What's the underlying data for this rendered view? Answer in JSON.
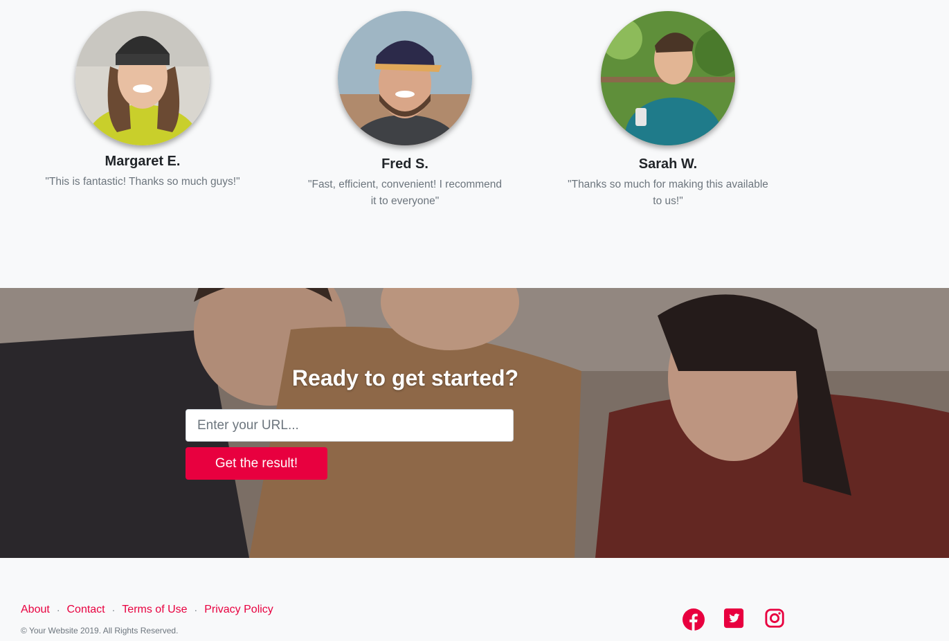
{
  "testimonials": [
    {
      "name": "Margaret E.",
      "quote": "\"This is fantastic! Thanks so much guys!\""
    },
    {
      "name": "Fred S.",
      "quote": "\"Fast, efficient, convenient! I recommend it to everyone\""
    },
    {
      "name": "Sarah W.",
      "quote": "\"Thanks so much for making this available to us!\""
    }
  ],
  "cta": {
    "title": "Ready to get started?",
    "input_placeholder": "Enter your URL...",
    "button_label": "Get the result!"
  },
  "footer": {
    "links": [
      "About",
      "Contact",
      "Terms of Use",
      "Privacy Policy"
    ],
    "separator": "·",
    "copyright": "© Your Website 2019. All Rights Reserved.",
    "social": [
      "facebook-icon",
      "twitter-icon",
      "instagram-icon"
    ]
  },
  "colors": {
    "accent": "#e8003f",
    "muted": "#6c757d",
    "background": "#f8f9fa"
  }
}
